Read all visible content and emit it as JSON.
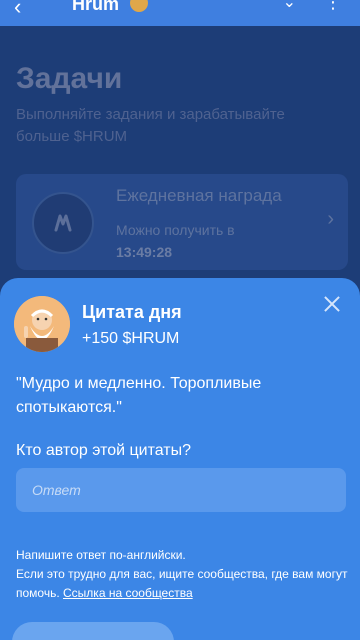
{
  "app": {
    "title": "Hrum",
    "back_glyph": "‹",
    "dropdown_glyph": "⌄",
    "more_glyph": "⋮"
  },
  "page": {
    "title": "Задачи",
    "subtitle": "Выполняйте задания и зарабатывайте больше $HRUM"
  },
  "reward_card": {
    "title": "Ежедневная награда",
    "subtitle": "Можно получить в",
    "time": "13:49:28",
    "chevron": "›"
  },
  "sheet": {
    "title": "Цитата дня",
    "reward": "+150 $HRUM",
    "quote": "\"Мудро и медленно. Торопливые спотыкаются.\"",
    "question": "Кто автор этой цитаты?",
    "input_placeholder": "Ответ",
    "input_value": "",
    "hint_line1": "Напишите ответ по-английски.",
    "hint_line2": "Если это трудно для вас, ищите сообщества, где вам могут помочь.",
    "hint_link": "Ссылка на сообщества"
  },
  "colors": {
    "sheet_bg": "#3c86e6",
    "overlay_bg": "#1d3d77",
    "input_bg": "#5a99ec"
  },
  "icons": {
    "close": "close-icon",
    "avatar": "sage-avatar-icon",
    "reward": "hrum-logo-icon"
  }
}
